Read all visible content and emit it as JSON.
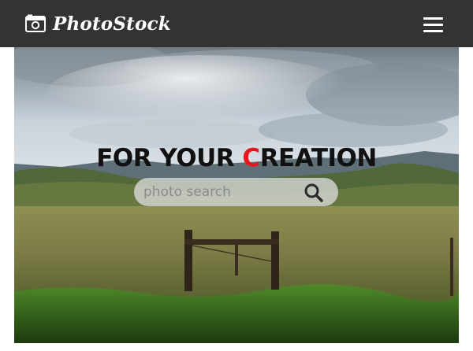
{
  "navbar": {
    "brand_name": "PhotoStock",
    "brand_icon": "camera-icon",
    "menu_icon": "hamburger-menu-icon"
  },
  "hero": {
    "headline_prefix": "FOR YOUR ",
    "headline_accent": "C",
    "headline_suffix": "REATION",
    "search": {
      "placeholder": "photo search",
      "value": "",
      "icon": "search-icon"
    }
  },
  "colors": {
    "navbar_bg": "#333333",
    "accent": "#e8141e",
    "headline_text": "#111111"
  }
}
